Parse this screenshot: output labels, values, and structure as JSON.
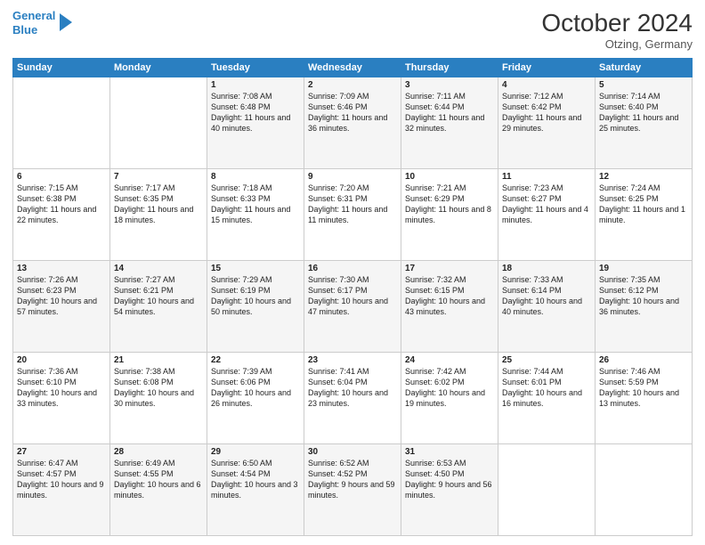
{
  "header": {
    "logo_line1": "General",
    "logo_line2": "Blue",
    "month_year": "October 2024",
    "location": "Otzing, Germany"
  },
  "weekdays": [
    "Sunday",
    "Monday",
    "Tuesday",
    "Wednesday",
    "Thursday",
    "Friday",
    "Saturday"
  ],
  "weeks": [
    [
      {
        "day": "",
        "sunrise": "",
        "sunset": "",
        "daylight": ""
      },
      {
        "day": "",
        "sunrise": "",
        "sunset": "",
        "daylight": ""
      },
      {
        "day": "1",
        "sunrise": "Sunrise: 7:08 AM",
        "sunset": "Sunset: 6:48 PM",
        "daylight": "Daylight: 11 hours and 40 minutes."
      },
      {
        "day": "2",
        "sunrise": "Sunrise: 7:09 AM",
        "sunset": "Sunset: 6:46 PM",
        "daylight": "Daylight: 11 hours and 36 minutes."
      },
      {
        "day": "3",
        "sunrise": "Sunrise: 7:11 AM",
        "sunset": "Sunset: 6:44 PM",
        "daylight": "Daylight: 11 hours and 32 minutes."
      },
      {
        "day": "4",
        "sunrise": "Sunrise: 7:12 AM",
        "sunset": "Sunset: 6:42 PM",
        "daylight": "Daylight: 11 hours and 29 minutes."
      },
      {
        "day": "5",
        "sunrise": "Sunrise: 7:14 AM",
        "sunset": "Sunset: 6:40 PM",
        "daylight": "Daylight: 11 hours and 25 minutes."
      }
    ],
    [
      {
        "day": "6",
        "sunrise": "Sunrise: 7:15 AM",
        "sunset": "Sunset: 6:38 PM",
        "daylight": "Daylight: 11 hours and 22 minutes."
      },
      {
        "day": "7",
        "sunrise": "Sunrise: 7:17 AM",
        "sunset": "Sunset: 6:35 PM",
        "daylight": "Daylight: 11 hours and 18 minutes."
      },
      {
        "day": "8",
        "sunrise": "Sunrise: 7:18 AM",
        "sunset": "Sunset: 6:33 PM",
        "daylight": "Daylight: 11 hours and 15 minutes."
      },
      {
        "day": "9",
        "sunrise": "Sunrise: 7:20 AM",
        "sunset": "Sunset: 6:31 PM",
        "daylight": "Daylight: 11 hours and 11 minutes."
      },
      {
        "day": "10",
        "sunrise": "Sunrise: 7:21 AM",
        "sunset": "Sunset: 6:29 PM",
        "daylight": "Daylight: 11 hours and 8 minutes."
      },
      {
        "day": "11",
        "sunrise": "Sunrise: 7:23 AM",
        "sunset": "Sunset: 6:27 PM",
        "daylight": "Daylight: 11 hours and 4 minutes."
      },
      {
        "day": "12",
        "sunrise": "Sunrise: 7:24 AM",
        "sunset": "Sunset: 6:25 PM",
        "daylight": "Daylight: 11 hours and 1 minute."
      }
    ],
    [
      {
        "day": "13",
        "sunrise": "Sunrise: 7:26 AM",
        "sunset": "Sunset: 6:23 PM",
        "daylight": "Daylight: 10 hours and 57 minutes."
      },
      {
        "day": "14",
        "sunrise": "Sunrise: 7:27 AM",
        "sunset": "Sunset: 6:21 PM",
        "daylight": "Daylight: 10 hours and 54 minutes."
      },
      {
        "day": "15",
        "sunrise": "Sunrise: 7:29 AM",
        "sunset": "Sunset: 6:19 PM",
        "daylight": "Daylight: 10 hours and 50 minutes."
      },
      {
        "day": "16",
        "sunrise": "Sunrise: 7:30 AM",
        "sunset": "Sunset: 6:17 PM",
        "daylight": "Daylight: 10 hours and 47 minutes."
      },
      {
        "day": "17",
        "sunrise": "Sunrise: 7:32 AM",
        "sunset": "Sunset: 6:15 PM",
        "daylight": "Daylight: 10 hours and 43 minutes."
      },
      {
        "day": "18",
        "sunrise": "Sunrise: 7:33 AM",
        "sunset": "Sunset: 6:14 PM",
        "daylight": "Daylight: 10 hours and 40 minutes."
      },
      {
        "day": "19",
        "sunrise": "Sunrise: 7:35 AM",
        "sunset": "Sunset: 6:12 PM",
        "daylight": "Daylight: 10 hours and 36 minutes."
      }
    ],
    [
      {
        "day": "20",
        "sunrise": "Sunrise: 7:36 AM",
        "sunset": "Sunset: 6:10 PM",
        "daylight": "Daylight: 10 hours and 33 minutes."
      },
      {
        "day": "21",
        "sunrise": "Sunrise: 7:38 AM",
        "sunset": "Sunset: 6:08 PM",
        "daylight": "Daylight: 10 hours and 30 minutes."
      },
      {
        "day": "22",
        "sunrise": "Sunrise: 7:39 AM",
        "sunset": "Sunset: 6:06 PM",
        "daylight": "Daylight: 10 hours and 26 minutes."
      },
      {
        "day": "23",
        "sunrise": "Sunrise: 7:41 AM",
        "sunset": "Sunset: 6:04 PM",
        "daylight": "Daylight: 10 hours and 23 minutes."
      },
      {
        "day": "24",
        "sunrise": "Sunrise: 7:42 AM",
        "sunset": "Sunset: 6:02 PM",
        "daylight": "Daylight: 10 hours and 19 minutes."
      },
      {
        "day": "25",
        "sunrise": "Sunrise: 7:44 AM",
        "sunset": "Sunset: 6:01 PM",
        "daylight": "Daylight: 10 hours and 16 minutes."
      },
      {
        "day": "26",
        "sunrise": "Sunrise: 7:46 AM",
        "sunset": "Sunset: 5:59 PM",
        "daylight": "Daylight: 10 hours and 13 minutes."
      }
    ],
    [
      {
        "day": "27",
        "sunrise": "Sunrise: 6:47 AM",
        "sunset": "Sunset: 4:57 PM",
        "daylight": "Daylight: 10 hours and 9 minutes."
      },
      {
        "day": "28",
        "sunrise": "Sunrise: 6:49 AM",
        "sunset": "Sunset: 4:55 PM",
        "daylight": "Daylight: 10 hours and 6 minutes."
      },
      {
        "day": "29",
        "sunrise": "Sunrise: 6:50 AM",
        "sunset": "Sunset: 4:54 PM",
        "daylight": "Daylight: 10 hours and 3 minutes."
      },
      {
        "day": "30",
        "sunrise": "Sunrise: 6:52 AM",
        "sunset": "Sunset: 4:52 PM",
        "daylight": "Daylight: 9 hours and 59 minutes."
      },
      {
        "day": "31",
        "sunrise": "Sunrise: 6:53 AM",
        "sunset": "Sunset: 4:50 PM",
        "daylight": "Daylight: 9 hours and 56 minutes."
      },
      {
        "day": "",
        "sunrise": "",
        "sunset": "",
        "daylight": ""
      },
      {
        "day": "",
        "sunrise": "",
        "sunset": "",
        "daylight": ""
      }
    ]
  ]
}
